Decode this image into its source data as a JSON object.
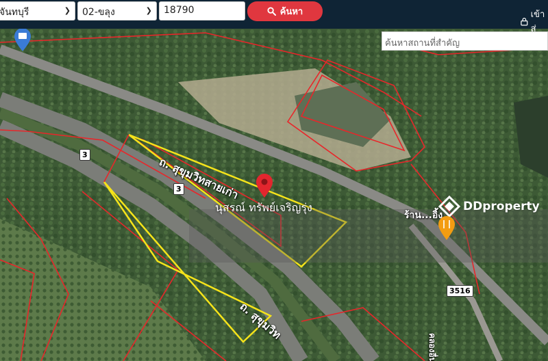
{
  "topbar": {
    "province_value": "จันทบุรี",
    "district_value": "02-ขลุง",
    "parcel_value": "18790",
    "search_label": "ค้นหา",
    "login_label": "เข้าสู่"
  },
  "map": {
    "place_search_placeholder": "ค้นหาสถานที่สำคัญ",
    "road_old_label": "ถ. สุขุมวิทสายเก่า",
    "road_new_label": "ถ. สุขุมวิท",
    "shield_3a": "3",
    "shield_3b": "3",
    "shield_3516": "3516",
    "property_label": "นุสรณ์ ทรัพย์เจริญรุ่ง",
    "shop_label": "ร้าน...อิ้ง",
    "vertical_road_label": "คลองอื่น...",
    "logo_text": "DDproperty",
    "colors": {
      "parcel_outline": "#e8262a",
      "selected_outline": "#f5e31a",
      "pin": "#e2262e",
      "restaurant_pin": "#f39c12"
    }
  }
}
